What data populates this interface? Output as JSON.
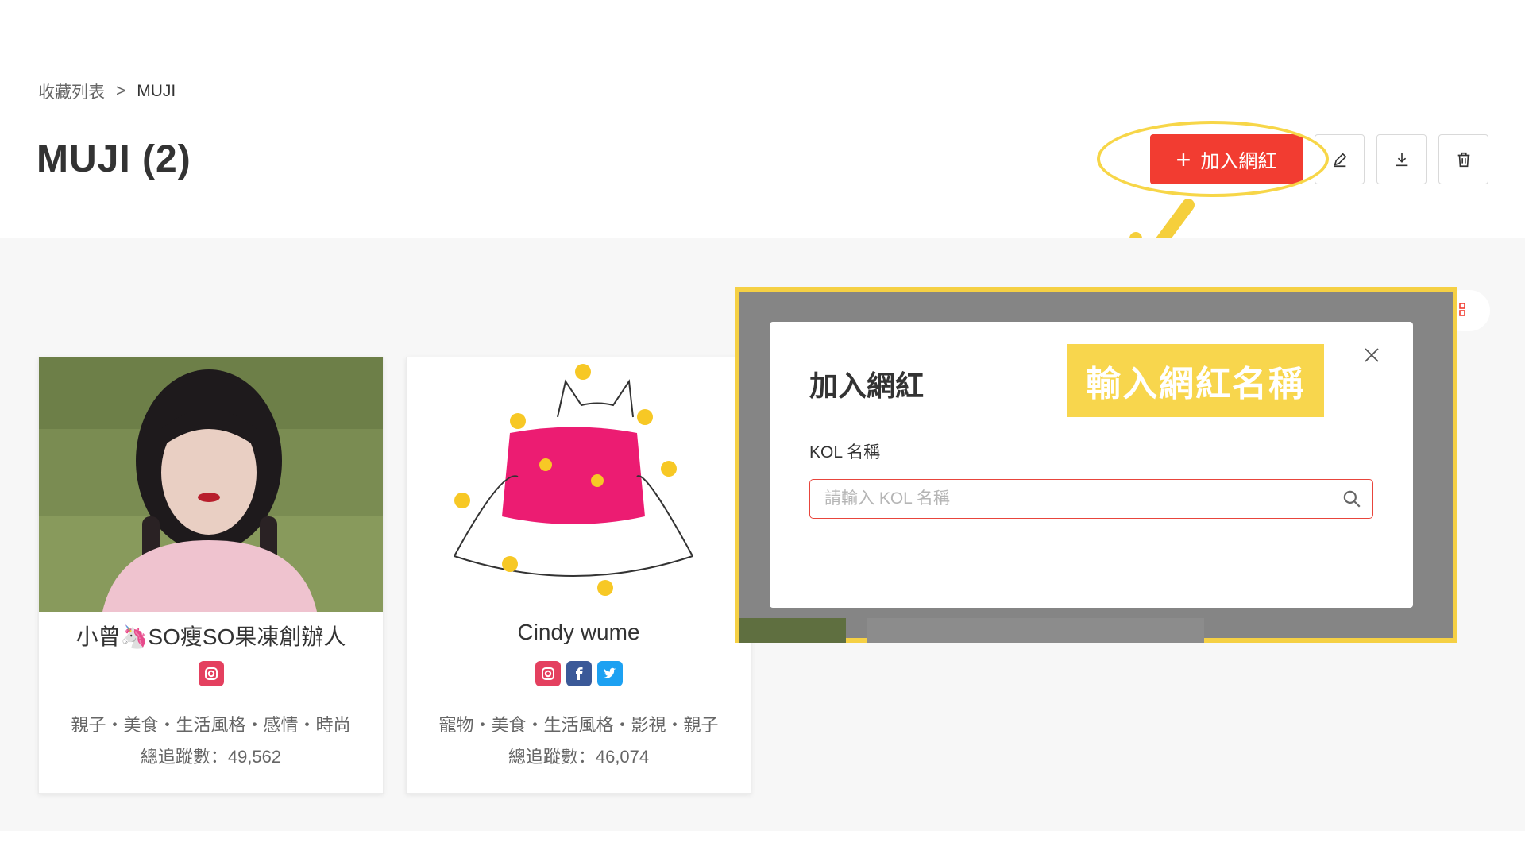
{
  "breadcrumb": {
    "root": "收藏列表",
    "separator": ">",
    "current": "MUJI"
  },
  "page_title": "MUJI (2)",
  "toolbar": {
    "add_label": "加入網紅",
    "add_icon": "plus-icon",
    "edit_icon": "pen-icon",
    "download_icon": "download-icon",
    "delete_icon": "trash-icon"
  },
  "cards": [
    {
      "name": "小曾🦄SO瘦SO果凍創辦人",
      "socials": [
        "instagram"
      ],
      "tags": "親子・美食・生活風格・感情・時尚",
      "followers": "總追蹤數：49,562"
    },
    {
      "name": "Cindy wume",
      "socials": [
        "instagram",
        "facebook",
        "twitter"
      ],
      "tags": "寵物・美食・生活風格・影視・親子",
      "followers": "總追蹤數：46,074"
    }
  ],
  "modal": {
    "title": "加入網紅",
    "field_label": "KOL 名稱",
    "field_placeholder": "請輸入 KOL 名稱",
    "field_value": ""
  },
  "annotation": {
    "callout_text": "輸入網紅名稱"
  },
  "colors": {
    "primary": "#f23c31",
    "highlight": "#f8d64d",
    "overlay": "#858585",
    "instagram": "#e4405f",
    "facebook": "#3b5998",
    "twitter": "#1da1f2"
  }
}
